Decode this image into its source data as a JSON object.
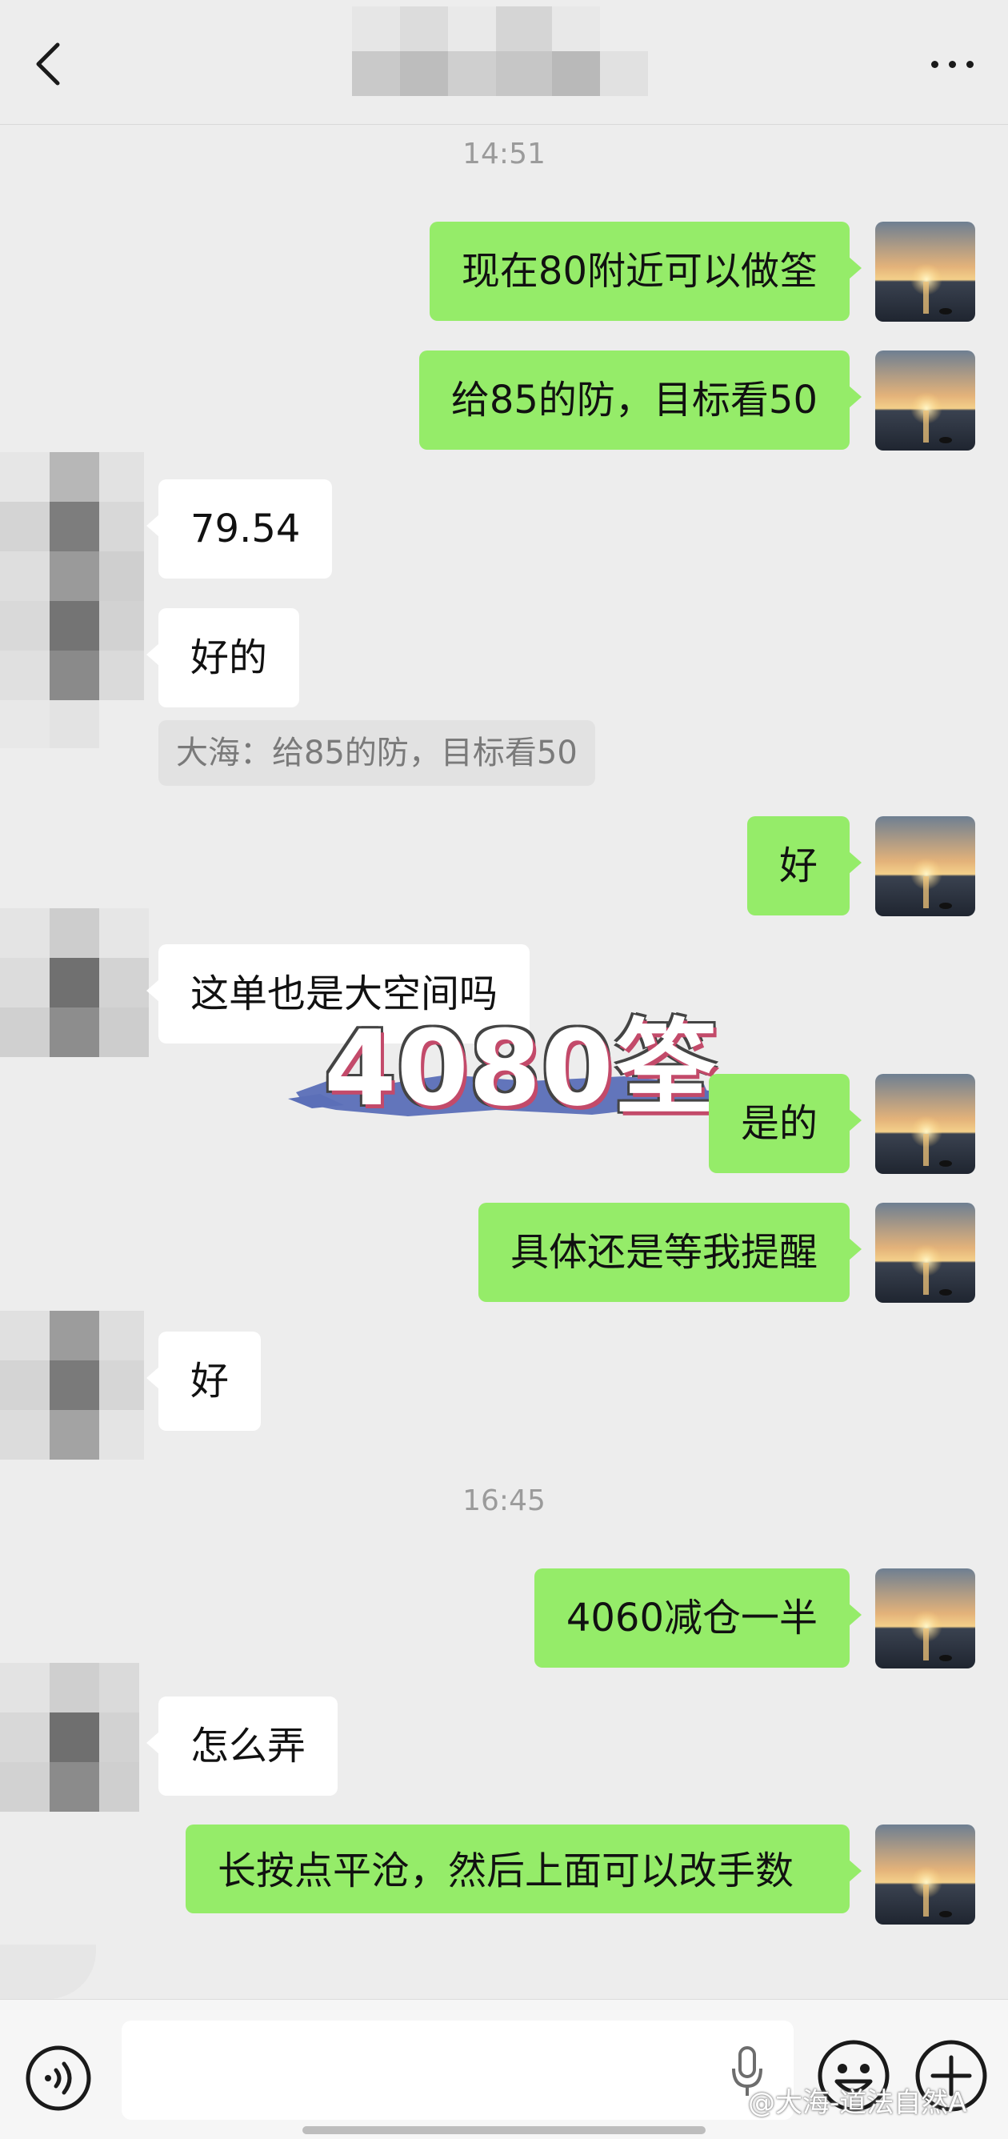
{
  "header": {
    "back_icon": "chevron-left-icon",
    "more_icon": "more-horizontal-icon"
  },
  "messages": {
    "time1": "14:51",
    "m1": "现在80附近可以做筌",
    "m2": "给85的防，目标看50",
    "m3": "79.54",
    "m4": "好的",
    "quote": "大海：给85的防，目标看50",
    "m5": "好",
    "m6": "这单也是大空间吗",
    "m7": "是的",
    "m8": "具体还是等我提醒",
    "m9": "好",
    "time2": "16:45",
    "m10": "4060减仓一半",
    "m11": "怎么弄",
    "m12": "长按点平沧，然后上面可以改手数"
  },
  "overlay": {
    "text": "4080筌"
  },
  "input_bar": {
    "voice_icon": "voice-icon",
    "mic_icon": "microphone-icon",
    "emoji_icon": "emoji-icon",
    "plus_icon": "plus-icon"
  },
  "watermark": "@大海-道法自然A",
  "colors": {
    "outgoing": "#95ec69",
    "incoming": "#ffffff",
    "background": "#ededed"
  }
}
